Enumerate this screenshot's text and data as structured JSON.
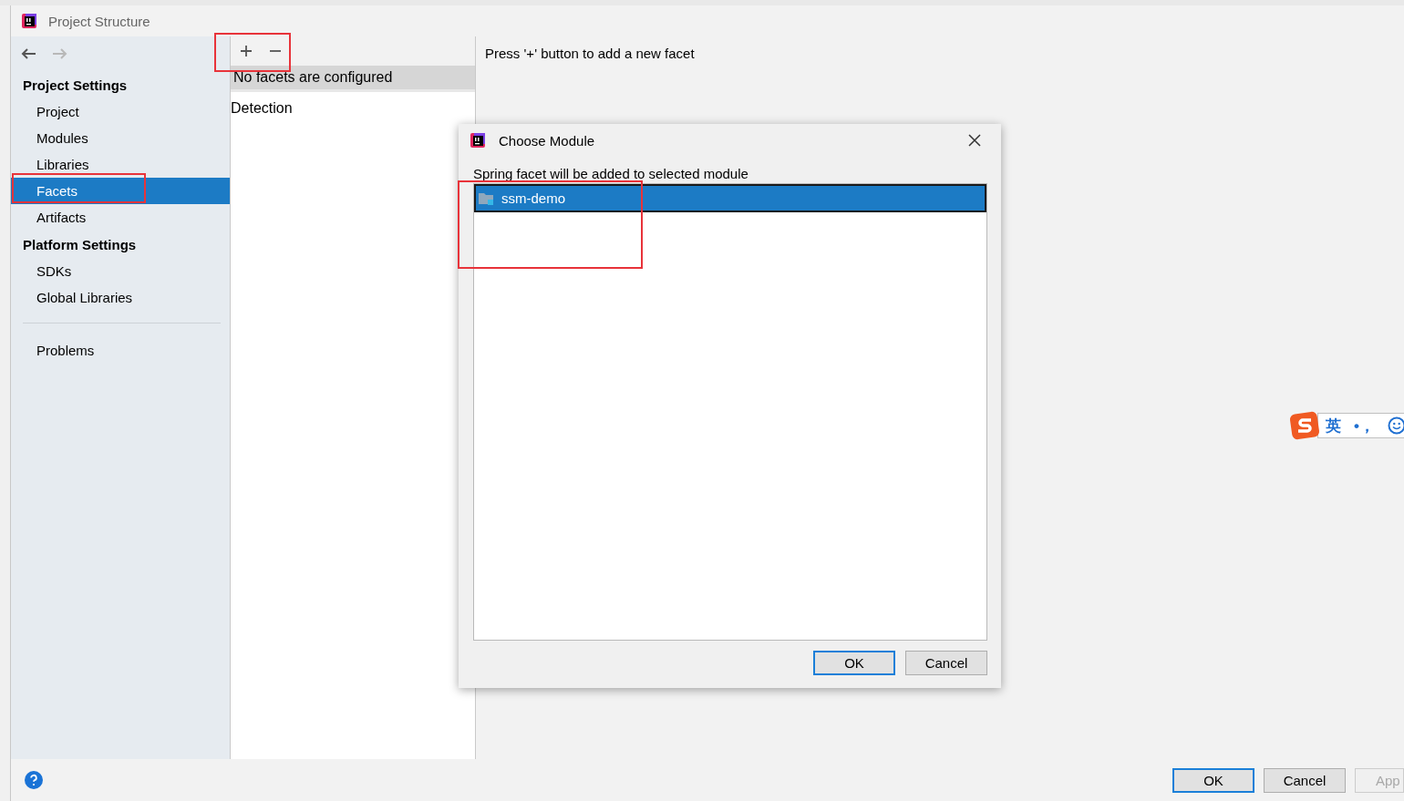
{
  "window": {
    "title": "Project Structure"
  },
  "nav": {
    "back_disabled": false,
    "forward_disabled": true
  },
  "sidebar": {
    "groups": [
      {
        "heading": "Project Settings",
        "items": [
          {
            "label": "Project",
            "selected": false,
            "highlighted": false
          },
          {
            "label": "Modules",
            "selected": false,
            "highlighted": false
          },
          {
            "label": "Libraries",
            "selected": false,
            "highlighted": false
          },
          {
            "label": "Facets",
            "selected": true,
            "highlighted": true
          },
          {
            "label": "Artifacts",
            "selected": false,
            "highlighted": false
          }
        ]
      },
      {
        "heading": "Platform Settings",
        "items": [
          {
            "label": "SDKs",
            "selected": false,
            "highlighted": false
          },
          {
            "label": "Global Libraries",
            "selected": false,
            "highlighted": false
          }
        ]
      }
    ],
    "footer_items": [
      {
        "label": "Problems",
        "selected": false
      }
    ]
  },
  "facets_panel": {
    "toolbar_highlighted": true,
    "tools": [
      {
        "kind": "add"
      },
      {
        "kind": "remove"
      }
    ],
    "header": "No facets are configured",
    "items": [
      "Detection"
    ]
  },
  "detail": {
    "hint": "Press '+' button to add a new facet"
  },
  "dialog": {
    "title": "Choose Module",
    "message": "Spring facet will be added to selected module",
    "modules": [
      {
        "name": "ssm-demo",
        "selected": true,
        "highlighted": true
      }
    ],
    "buttons": [
      {
        "label": "OK",
        "focused": true
      },
      {
        "label": "Cancel",
        "focused": false
      }
    ]
  },
  "footer": {
    "buttons": [
      {
        "label": "OK",
        "focused": true,
        "disabled": false
      },
      {
        "label": "Cancel",
        "focused": false,
        "disabled": false
      },
      {
        "label": "App",
        "focused": false,
        "disabled": true
      }
    ]
  },
  "ime": {
    "mode": "英",
    "punctuation": "•，"
  }
}
